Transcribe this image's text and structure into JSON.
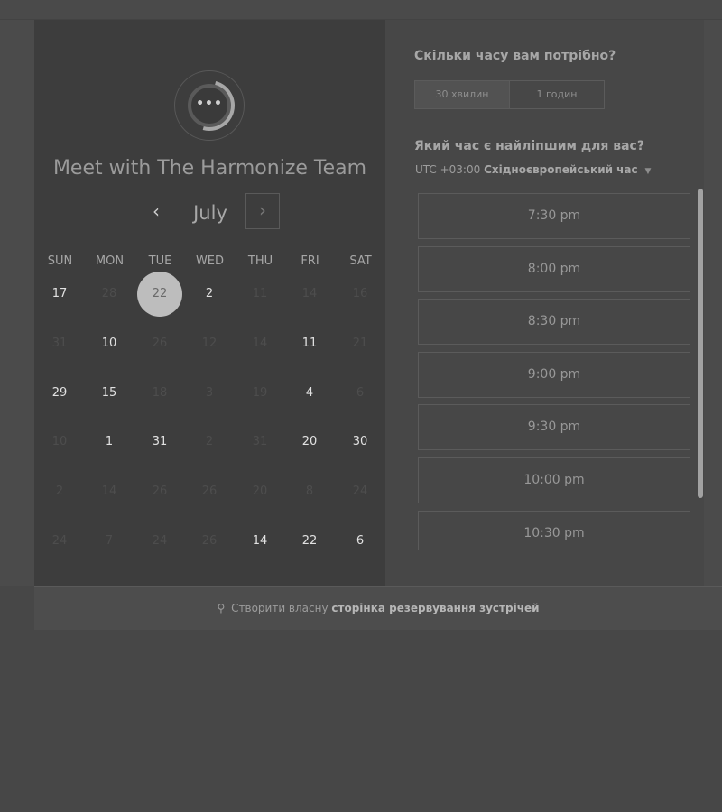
{
  "meeting": {
    "title": "Meet with The Harmonize Team",
    "avatar_icon": "more-dots-icon"
  },
  "calendar": {
    "month": "July",
    "prev_icon": "‹",
    "next_icon": "›",
    "day_headers": [
      "SUN",
      "MON",
      "TUE",
      "WED",
      "THU",
      "FRI",
      "SAT"
    ],
    "weeks": [
      [
        {
          "d": "17",
          "s": "active"
        },
        {
          "d": "28",
          "s": "muted"
        },
        {
          "d": "22",
          "s": "selected"
        },
        {
          "d": "2",
          "s": "active"
        },
        {
          "d": "11",
          "s": "muted"
        },
        {
          "d": "14",
          "s": "muted"
        },
        {
          "d": "16",
          "s": "muted"
        }
      ],
      [
        {
          "d": "31",
          "s": "muted"
        },
        {
          "d": "10",
          "s": "active"
        },
        {
          "d": "26",
          "s": "muted"
        },
        {
          "d": "12",
          "s": "muted"
        },
        {
          "d": "14",
          "s": "muted"
        },
        {
          "d": "11",
          "s": "active"
        },
        {
          "d": "21",
          "s": "muted"
        }
      ],
      [
        {
          "d": "29",
          "s": "active"
        },
        {
          "d": "15",
          "s": "active"
        },
        {
          "d": "18",
          "s": "muted"
        },
        {
          "d": "3",
          "s": "muted"
        },
        {
          "d": "19",
          "s": "muted"
        },
        {
          "d": "4",
          "s": "active"
        },
        {
          "d": "6",
          "s": "muted"
        }
      ],
      [
        {
          "d": "10",
          "s": "muted"
        },
        {
          "d": "1",
          "s": "active"
        },
        {
          "d": "31",
          "s": "active"
        },
        {
          "d": "2",
          "s": "muted"
        },
        {
          "d": "31",
          "s": "muted"
        },
        {
          "d": "20",
          "s": "active"
        },
        {
          "d": "30",
          "s": "active"
        }
      ],
      [
        {
          "d": "2",
          "s": "muted"
        },
        {
          "d": "14",
          "s": "muted"
        },
        {
          "d": "26",
          "s": "muted"
        },
        {
          "d": "26",
          "s": "muted"
        },
        {
          "d": "20",
          "s": "muted"
        },
        {
          "d": "8",
          "s": "muted"
        },
        {
          "d": "24",
          "s": "muted"
        }
      ],
      [
        {
          "d": "24",
          "s": "muted"
        },
        {
          "d": "7",
          "s": "muted"
        },
        {
          "d": "24",
          "s": "muted"
        },
        {
          "d": "26",
          "s": "muted"
        },
        {
          "d": "14",
          "s": "active"
        },
        {
          "d": "22",
          "s": "active"
        },
        {
          "d": "6",
          "s": "active"
        }
      ]
    ]
  },
  "duration": {
    "question": "Скільки часу вам потрібно?",
    "options": [
      "30 хвилин",
      "1 годин"
    ],
    "selected_index": 0
  },
  "time": {
    "question": "Який час є найліпшим для вас?",
    "timezone_offset": "UTC +03:00",
    "timezone_name": "Східноєвропейський час",
    "slots": [
      "7:30 pm",
      "8:00 pm",
      "8:30 pm",
      "9:00 pm",
      "9:30 pm",
      "10:00 pm",
      "10:30 pm"
    ]
  },
  "footer": {
    "icon": "hubspot-sprocket-icon",
    "prefix": "Створити власну",
    "link": "сторінка резервування зустрічей"
  }
}
